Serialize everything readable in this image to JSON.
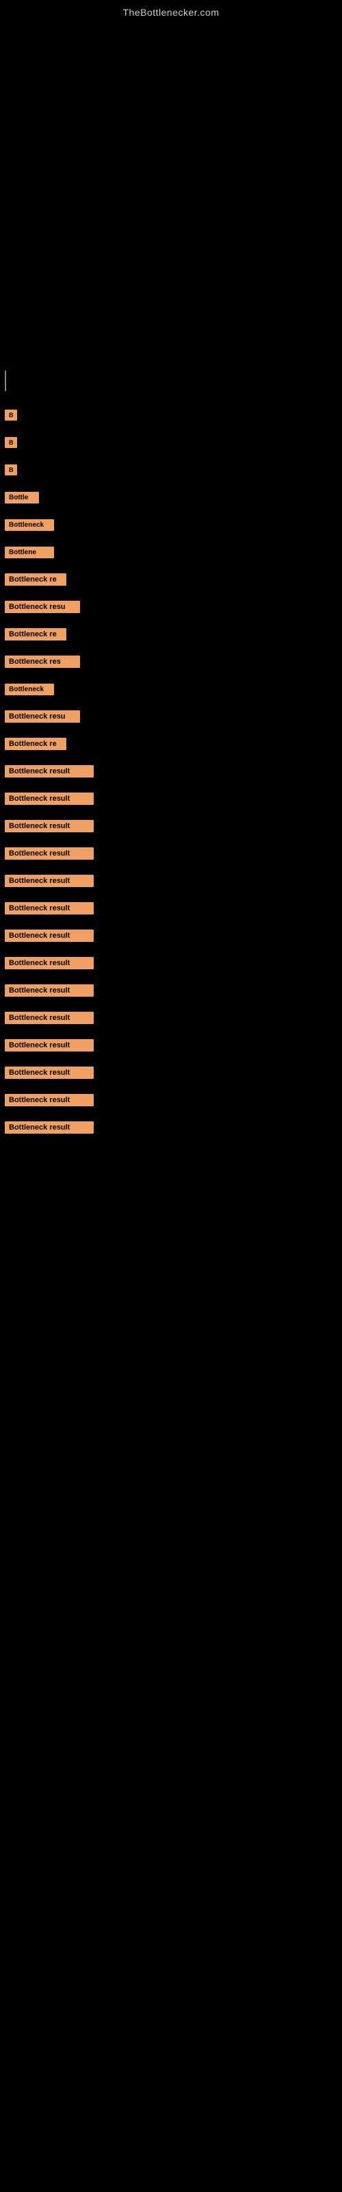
{
  "site": {
    "title": "TheBottlenecker.com"
  },
  "results": [
    {
      "id": 1,
      "label": "Bottleneck result",
      "badgeClass": "badge-xs",
      "display": "B"
    },
    {
      "id": 2,
      "label": "Bottleneck result",
      "badgeClass": "badge-xs",
      "display": "B"
    },
    {
      "id": 3,
      "label": "Bottleneck result",
      "badgeClass": "badge-xs",
      "display": "B"
    },
    {
      "id": 4,
      "label": "Bottleneck result",
      "badgeClass": "badge-md",
      "display": "Bottle"
    },
    {
      "id": 5,
      "label": "Bottleneck result",
      "badgeClass": "badge-lg",
      "display": "Bottleneck"
    },
    {
      "id": 6,
      "label": "Bottleneck result",
      "badgeClass": "badge-lg",
      "display": "Bottlene"
    },
    {
      "id": 7,
      "label": "Bottleneck result",
      "badgeClass": "badge-xl",
      "display": "Bottleneck re"
    },
    {
      "id": 8,
      "label": "Bottleneck result",
      "badgeClass": "badge-xxl",
      "display": "Bottleneck resu"
    },
    {
      "id": 9,
      "label": "Bottleneck result",
      "badgeClass": "badge-xl",
      "display": "Bottleneck re"
    },
    {
      "id": 10,
      "label": "Bottleneck result",
      "badgeClass": "badge-xxl",
      "display": "Bottleneck res"
    },
    {
      "id": 11,
      "label": "Bottleneck result",
      "badgeClass": "badge-lg",
      "display": "Bottleneck"
    },
    {
      "id": 12,
      "label": "Bottleneck result",
      "badgeClass": "badge-xxl",
      "display": "Bottleneck resu"
    },
    {
      "id": 13,
      "label": "Bottleneck result",
      "badgeClass": "badge-xl",
      "display": "Bottleneck re"
    },
    {
      "id": 14,
      "label": "Bottleneck result",
      "badgeClass": "badge-full",
      "display": "Bottleneck result"
    },
    {
      "id": 15,
      "label": "Bottleneck result",
      "badgeClass": "badge-full",
      "display": "Bottleneck result"
    },
    {
      "id": 16,
      "label": "Bottleneck result",
      "badgeClass": "badge-full",
      "display": "Bottleneck result"
    },
    {
      "id": 17,
      "label": "Bottleneck result",
      "badgeClass": "badge-full",
      "display": "Bottleneck result"
    },
    {
      "id": 18,
      "label": "Bottleneck result",
      "badgeClass": "badge-full",
      "display": "Bottleneck result"
    },
    {
      "id": 19,
      "label": "Bottleneck result",
      "badgeClass": "badge-full",
      "display": "Bottleneck result"
    },
    {
      "id": 20,
      "label": "Bottleneck result",
      "badgeClass": "badge-full",
      "display": "Bottleneck result"
    },
    {
      "id": 21,
      "label": "Bottleneck result",
      "badgeClass": "badge-full",
      "display": "Bottleneck result"
    },
    {
      "id": 22,
      "label": "Bottleneck result",
      "badgeClass": "badge-full",
      "display": "Bottleneck result"
    },
    {
      "id": 23,
      "label": "Bottleneck result",
      "badgeClass": "badge-full",
      "display": "Bottleneck result"
    },
    {
      "id": 24,
      "label": "Bottleneck result",
      "badgeClass": "badge-full",
      "display": "Bottleneck result"
    },
    {
      "id": 25,
      "label": "Bottleneck result",
      "badgeClass": "badge-full",
      "display": "Bottleneck result"
    },
    {
      "id": 26,
      "label": "Bottleneck result",
      "badgeClass": "badge-full",
      "display": "Bottleneck result"
    },
    {
      "id": 27,
      "label": "Bottleneck result",
      "badgeClass": "badge-full",
      "display": "Bottleneck result"
    }
  ]
}
